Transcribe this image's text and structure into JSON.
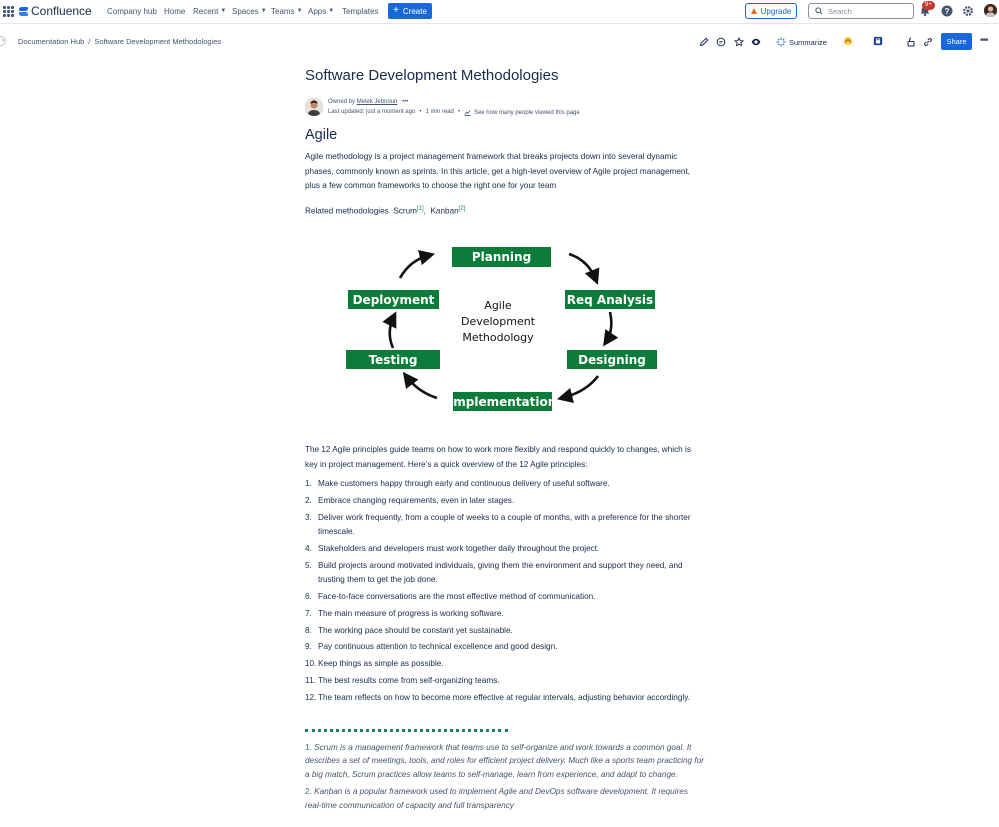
{
  "nav": {
    "brand": "Confluence",
    "items": [
      {
        "label": "Company hub",
        "chevron": false
      },
      {
        "label": "Home",
        "chevron": false
      },
      {
        "label": "Recent",
        "chevron": true
      },
      {
        "label": "Spaces",
        "chevron": true
      },
      {
        "label": "Teams",
        "chevron": true
      },
      {
        "label": "Apps",
        "chevron": true
      },
      {
        "label": "Templates",
        "chevron": false
      }
    ],
    "create_label": "Create",
    "upgrade_label": "Upgrade",
    "search_placeholder": "Search",
    "notification_count": "9+",
    "icons": [
      "app-switcher-icon",
      "notifications-icon",
      "help-icon",
      "settings-icon",
      "profile-avatar"
    ]
  },
  "breadcrumb": [
    "Documentation Hub",
    "/",
    "Software Development Methodologies"
  ],
  "toolbar": {
    "summarize_label": "Summarize",
    "share_label": "Share",
    "icons": [
      "edit-icon",
      "comment-icon",
      "star-icon",
      "watch-icon",
      "summarize-icon",
      "app-icon",
      "app-icon-2",
      "restrictions-icon",
      "copy-link-icon",
      "more-icon"
    ]
  },
  "page": {
    "title": "Software Development Methodologies",
    "owned_by_prefix": "Owned by",
    "owner": "Melek Jebnoun",
    "last_updated": "Last updated: just a moment ago",
    "read_time": "1 min read",
    "viewers_link": "See how many people viewed this page"
  },
  "agile": {
    "heading": "Agile",
    "intro": "Agile methodology is a project management framework that breaks projects down into several dynamic phases, commonly known as sprints. In this article, get a high-level overview of Agile project management, plus a few common frameworks to choose the right one for your team",
    "related_prefix": "Related methodologies",
    "related": [
      {
        "label": "Scrum",
        "ref": "[1]"
      },
      {
        "label": "Kanban",
        "ref": "[2]"
      }
    ]
  },
  "diagram": {
    "center": [
      "Agile",
      "Development",
      "Methodology"
    ],
    "stages": [
      "Planning",
      "Req Analysis",
      "Designing",
      "Implementation",
      "Testing",
      "Deployment"
    ],
    "stage_color": "#0d7c3a"
  },
  "principles_intro": "The 12 Agile principles guide teams on how to work more flexibly and respond quickly to changes, which is key in project management. Here’s a quick overview of the 12 Agile principles:",
  "principles": [
    "Make customers happy through early and continuous delivery of useful software.",
    "Embrace changing requirements, even in later stages.",
    "Deliver work frequently, from a couple of weeks to a couple of months, with a preference for the shorter timescale.",
    "Stakeholders and developers must work together daily throughout the project.",
    "Build projects around motivated individuals, giving them the environment and support they need, and trusting them to get the job done.",
    "Face-to-face conversations are the most effective method of communication.",
    "The main measure of progress is working software.",
    "The working pace should be constant yet sustainable.",
    "Pay continuous attention to technical excellence and good design.",
    "Keep things as simple as possible.",
    "The best results come from self-organizing teams.",
    "The team reflects on how to become more effective at regular intervals, adjusting behavior accordingly."
  ],
  "principle_numbers": [
    "1.",
    "2.",
    "3.",
    "4.",
    "5.",
    "6.",
    "7.",
    "8.",
    "9.",
    "10.",
    "11.",
    "12."
  ],
  "footnotes": [
    {
      "num": "1.",
      "text": "Scrum is a management framework that teams use to self-organize and work towards a common goal. It describes a set of meetings, tools, and roles for efficient project delivery. Much like a sports team practicing for a big match, Scrum practices allow teams to self-manage, learn from experience, and adapt to change."
    },
    {
      "num": "2.",
      "text": "Kanban is a popular framework used to implement Agile and DevOps software development. It requires real-time communication of capacity and full transparency"
    }
  ],
  "colors": {
    "primary": "#1868db",
    "text": "#172b4d",
    "subtle": "#44546f",
    "green": "#1f845a"
  }
}
